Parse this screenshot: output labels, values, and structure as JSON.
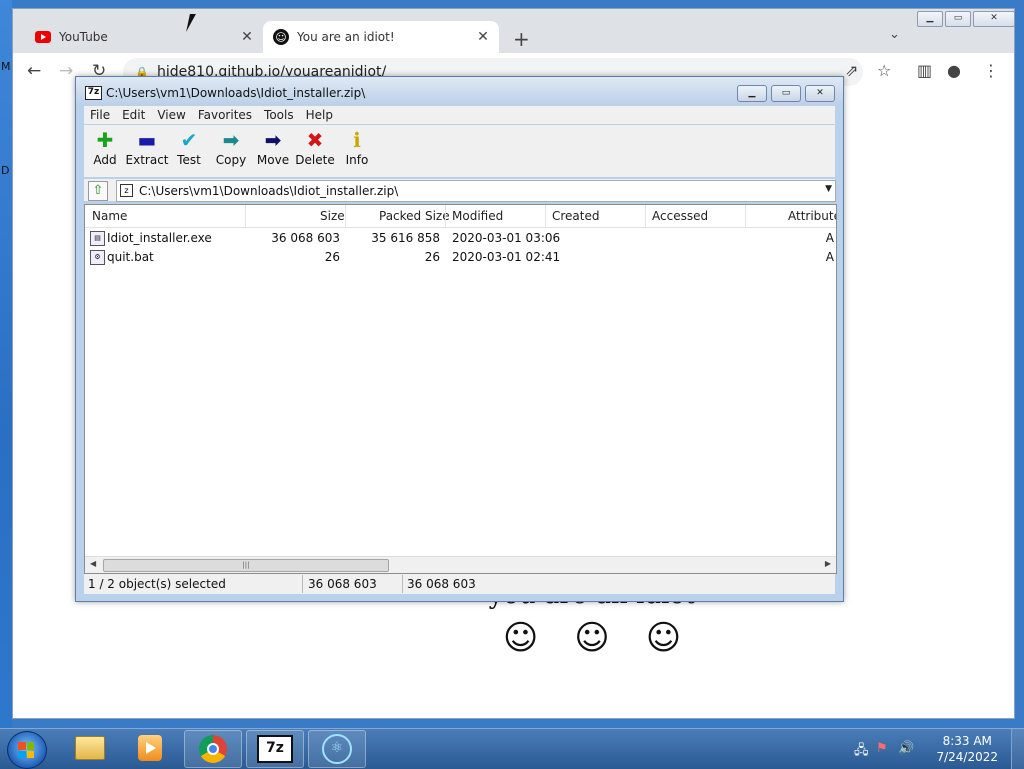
{
  "browser": {
    "tabs": [
      {
        "title": "YouTube",
        "icon": "youtube-icon"
      },
      {
        "title": "You are an idiot!",
        "icon": "idiot-face-icon"
      }
    ],
    "url": "hide810.github.io/youareanidiot/"
  },
  "desktop": {
    "left_letters": [
      "M",
      "D"
    ]
  },
  "page": {
    "message": "you are an idiot",
    "faces": [
      "☺",
      "☺",
      "☺"
    ]
  },
  "sevenzip": {
    "title": "C:\\Users\\vm1\\Downloads\\Idiot_installer.zip\\",
    "menu": [
      "File",
      "Edit",
      "View",
      "Favorites",
      "Tools",
      "Help"
    ],
    "tools": [
      {
        "label": "Add",
        "glyph": "✚",
        "color": "#1aa31a",
        "icon": "add-icon"
      },
      {
        "label": "Extract",
        "glyph": "▬",
        "color": "#1a1aa8",
        "icon": "extract-icon"
      },
      {
        "label": "Test",
        "glyph": "✔",
        "color": "#18a8c8",
        "icon": "test-icon"
      },
      {
        "label": "Copy",
        "glyph": "➡",
        "color": "#1a8a8a",
        "icon": "copy-icon"
      },
      {
        "label": "Move",
        "glyph": "➡",
        "color": "#10106a",
        "icon": "move-icon"
      },
      {
        "label": "Delete",
        "glyph": "✖",
        "color": "#d01818",
        "icon": "delete-icon"
      },
      {
        "label": "Info",
        "glyph": "ℹ",
        "color": "#c8a800",
        "icon": "info-icon"
      }
    ],
    "address": "C:\\Users\\vm1\\Downloads\\Idiot_installer.zip\\",
    "columns": [
      "Name",
      "Size",
      "Packed Size",
      "Modified",
      "Created",
      "Accessed",
      "Attribute"
    ],
    "files": [
      {
        "name": "Idiot_installer.exe",
        "size": "36 068 603",
        "packed": "35 616 858",
        "modified": "2020-03-01 03:06",
        "attr": "A"
      },
      {
        "name": "quit.bat",
        "size": "26",
        "packed": "26",
        "modified": "2020-03-01 02:41",
        "attr": "A"
      }
    ],
    "status": {
      "selected": "1 / 2 object(s) selected",
      "size": "36 068 603",
      "packed": "36 068 603"
    }
  },
  "taskbar": {
    "clock_time": "8:33 AM",
    "clock_date": "7/24/2022"
  }
}
